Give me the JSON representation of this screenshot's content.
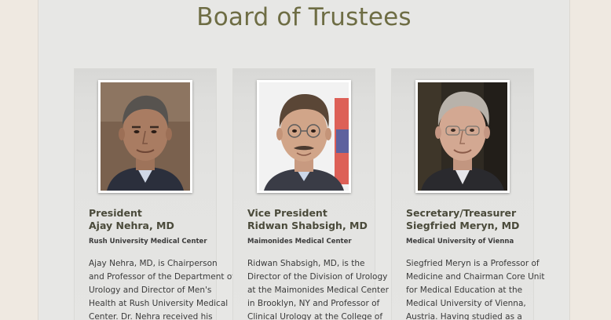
{
  "page": {
    "title": "Board of Trustees"
  },
  "trustees": [
    {
      "role": "President",
      "name": "Ajay Nehra, MD",
      "affiliation": "Rush University Medical Center",
      "bio_lines": [
        "Ajay Nehra, MD, is Chairperson",
        "and Professor of the Department of",
        "Urology and Director of Men's",
        "Health at Rush University Medical",
        "Center. Dr. Nehra received his"
      ]
    },
    {
      "role": "Vice President",
      "name": "Ridwan Shabsigh, MD",
      "affiliation": "Maimonides Medical Center",
      "bio_lines": [
        "Ridwan Shabsigh, MD, is the",
        "Director of the Division of Urology",
        "at the Maimonides Medical Center",
        "in Brooklyn, NY and Professor of",
        "Clinical Urology at the College of"
      ]
    },
    {
      "role": "Secretary/Treasurer",
      "name": "Siegfried Meryn, MD",
      "affiliation": "Medical University of Vienna",
      "bio_lines": [
        "Siegfried Meryn is a Professor of",
        "Medicine and Chairman Core Unit",
        "for Medical Education at the",
        "Medical University of Vienna,",
        "Austria. Having studied as a"
      ]
    }
  ],
  "colors": {
    "background": "#efe9e1",
    "panel": "#e7e7e5",
    "title": "#6e6d44",
    "heading_text": "#4a4a3a"
  }
}
